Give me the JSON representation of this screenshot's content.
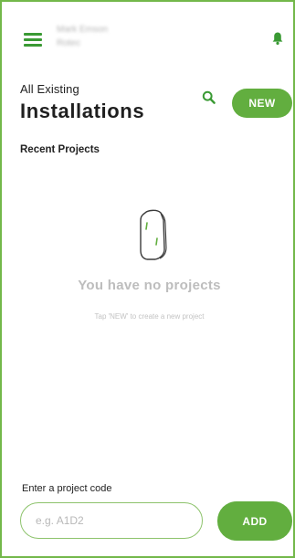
{
  "header": {
    "user_name": "Mark Emson",
    "user_org": "Rotec",
    "menu_icon": "hamburger-menu-icon",
    "notification_icon": "bell-icon"
  },
  "page": {
    "subtitle": "All Existing",
    "title": "Installations",
    "search_icon": "search-icon",
    "new_button": "NEW"
  },
  "projects": {
    "heading": "Recent Projects",
    "empty_icon": "device-icon",
    "empty_title": "You have no projects",
    "empty_hint": "Tap 'NEW' to create a new project",
    "items": []
  },
  "project_code": {
    "label": "Enter a project code",
    "placeholder": "e.g. A1D2",
    "value": "",
    "add_button": "ADD"
  },
  "colors": {
    "brand_green": "#62ae3f",
    "frame_border": "#73b84a",
    "icon_green": "#3a9a34"
  }
}
